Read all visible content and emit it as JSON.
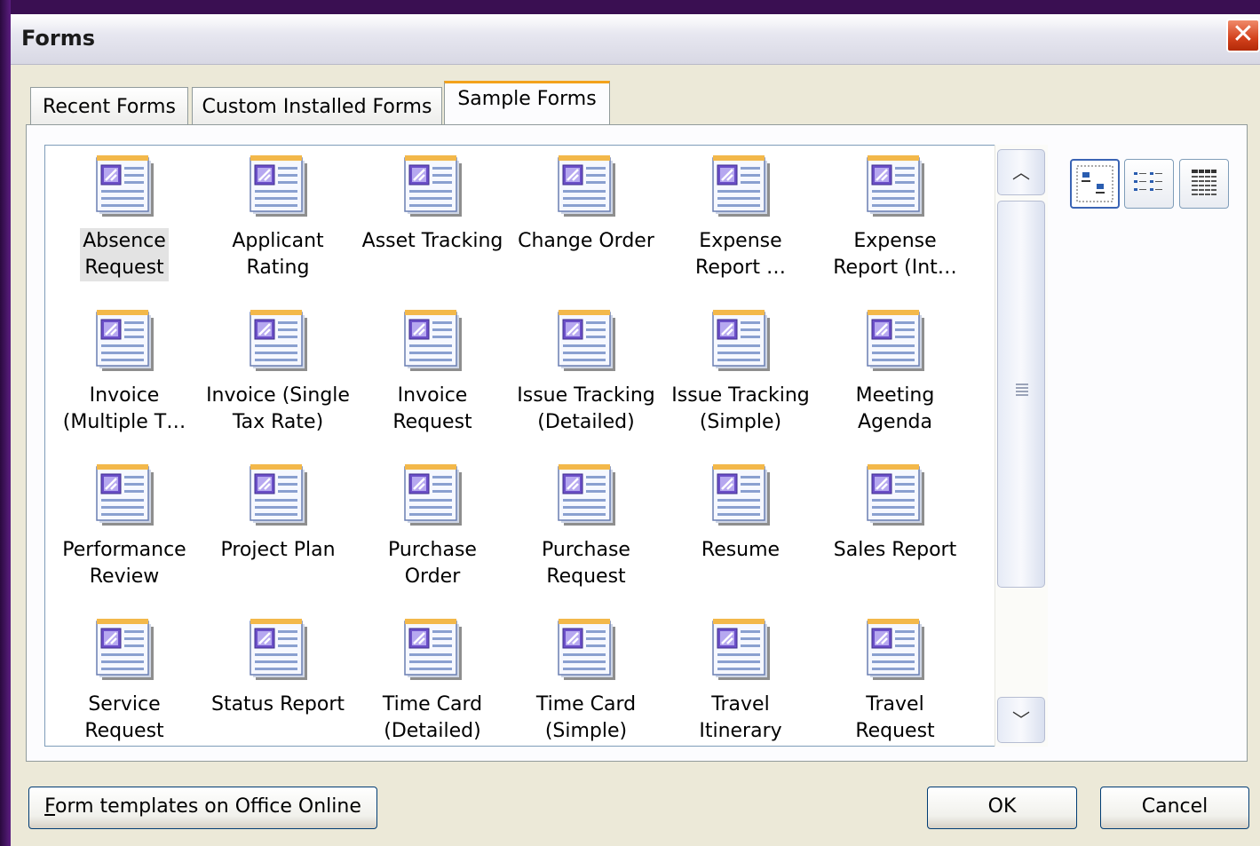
{
  "window": {
    "title": "Forms"
  },
  "tabs": [
    {
      "label": "Recent Forms"
    },
    {
      "label": "Custom Installed Forms"
    },
    {
      "label": "Sample Forms"
    }
  ],
  "items": [
    "Absence\nRequest",
    "Applicant\nRating",
    "Asset Tracking",
    "Change Order",
    "Expense\nReport …",
    "Expense\nReport (Int…",
    "Invoice\n(Multiple T…",
    "Invoice (Single\nTax Rate)",
    "Invoice\nRequest",
    "Issue Tracking\n(Detailed)",
    "Issue Tracking\n(Simple)",
    "Meeting\nAgenda",
    "Performance\nReview",
    "Project Plan",
    "Purchase\nOrder",
    "Purchase\nRequest",
    "Resume",
    "Sales Report",
    "Service\nRequest",
    "Status Report",
    "Time Card\n(Detailed)",
    "Time Card\n(Simple)",
    "Travel\nItinerary",
    "Travel\nRequest"
  ],
  "buttons": {
    "online_mnemonic": "F",
    "online_rest": "orm templates on Office Online",
    "ok": "OK",
    "cancel": "Cancel"
  },
  "view_modes": [
    "large-icons",
    "list",
    "details"
  ],
  "selected_item_index": 0,
  "colors": {
    "accent_tab": "#f3a21c",
    "close_button": "#d3411c",
    "background": "#3a0f52"
  }
}
